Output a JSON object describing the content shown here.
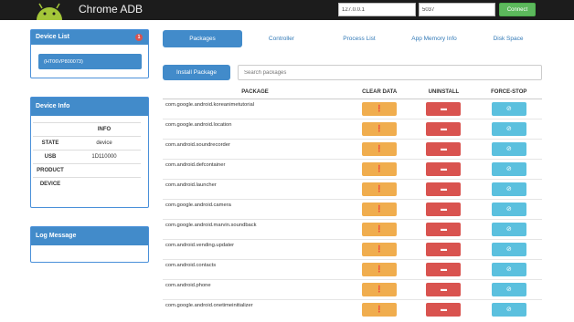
{
  "header": {
    "title": "Chrome ADB",
    "ip_value": "127.0.0.1",
    "port_value": "5037",
    "connect_label": "Connect"
  },
  "device_list": {
    "title": "Device List",
    "badge": "1",
    "device": "HT06VP800073"
  },
  "device_info": {
    "title": "Device Info",
    "col_header": "INFO",
    "rows": [
      {
        "key": "STATE",
        "value": "device"
      },
      {
        "key": "USB",
        "value": "1D110000"
      },
      {
        "key": "PRODUCT",
        "value": ""
      },
      {
        "key": "DEVICE",
        "value": ""
      }
    ]
  },
  "log": {
    "title": "Log Message"
  },
  "tabs": [
    {
      "label": "Packages",
      "active": true
    },
    {
      "label": "Controller",
      "active": false
    },
    {
      "label": "Process List",
      "active": false
    },
    {
      "label": "App Memory Info",
      "active": false
    },
    {
      "label": "Disk Space",
      "active": false
    }
  ],
  "toolbar": {
    "install_label": "Install Package",
    "search_placeholder": "Search packages"
  },
  "table": {
    "headers": [
      "PACKAGE",
      "CLEAR DATA",
      "UNINSTALL",
      "FORCE-STOP"
    ],
    "packages": [
      "com.google.android.koreanimetutorial",
      "com.google.android.location",
      "com.android.soundrecorder",
      "com.android.defcontainer",
      "com.android.launcher",
      "com.google.android.camera",
      "com.google.android.marvin.soundback",
      "com.android.vending.updater",
      "com.android.contacts",
      "com.android.phone",
      "com.google.android.onetimeinitializer"
    ]
  },
  "icons": {
    "clear": "broom-icon",
    "uninstall": "trash-icon",
    "stop": "ban-icon"
  },
  "colors": {
    "primary": "#428bca",
    "success": "#5cb85c",
    "warning": "#f0ad4e",
    "danger": "#d9534f",
    "info": "#5bc0de"
  }
}
